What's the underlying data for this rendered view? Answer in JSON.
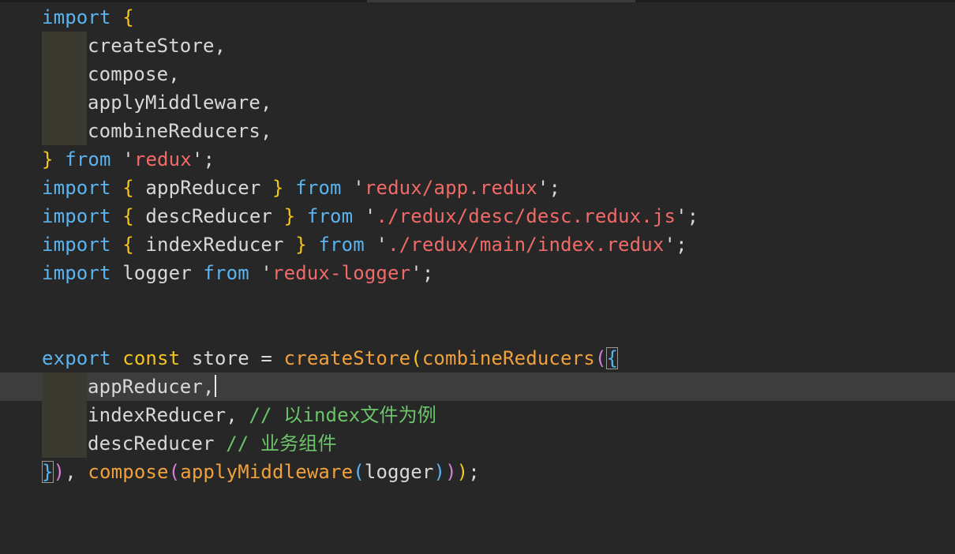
{
  "editor": {
    "lines": [
      {
        "id": "l1",
        "text": [
          "import",
          " ",
          "{"
        ]
      },
      {
        "id": "l2",
        "text": [
          "createStore",
          ","
        ]
      },
      {
        "id": "l3",
        "text": [
          "compose",
          ","
        ]
      },
      {
        "id": "l4",
        "text": [
          "applyMiddleware",
          ","
        ]
      },
      {
        "id": "l5",
        "text": [
          "combineReducers",
          ","
        ]
      },
      {
        "id": "l6",
        "text": [
          "}",
          " ",
          "from",
          " ",
          "'",
          "redux",
          "'",
          ";"
        ]
      },
      {
        "id": "l7",
        "text": [
          "import",
          " ",
          "{",
          " appReducer ",
          "}",
          " ",
          "from",
          " ",
          "'",
          "redux/app.redux",
          "'",
          ";"
        ]
      },
      {
        "id": "l8",
        "text": [
          "import",
          " ",
          "{",
          " descReducer ",
          "}",
          " ",
          "from",
          " ",
          "'",
          "./redux/desc/desc.redux.js",
          "'",
          ";"
        ]
      },
      {
        "id": "l9",
        "text": [
          "import",
          " ",
          "{",
          " indexReducer ",
          "}",
          " ",
          "from",
          " ",
          "'",
          "./redux/main/index.redux",
          "'",
          ";"
        ]
      },
      {
        "id": "l10",
        "text": [
          "import",
          " logger ",
          "from",
          " ",
          "'",
          "redux-logger",
          "'",
          ";"
        ]
      },
      {
        "id": "l13",
        "text": [
          "export",
          " ",
          "const",
          " store = ",
          "createStore",
          "(",
          "combineReducers",
          "(",
          "{"
        ]
      },
      {
        "id": "l14",
        "text": [
          "appReducer",
          ","
        ]
      },
      {
        "id": "l15",
        "text": [
          "indexReducer",
          ", ",
          "// 以index文件为例"
        ]
      },
      {
        "id": "l16",
        "text": [
          "descReducer",
          " ",
          "// 业务组件"
        ]
      },
      {
        "id": "l17",
        "text": [
          "}",
          ")",
          ", ",
          "compose",
          "(",
          "applyMiddleware",
          "(",
          "logger",
          ")",
          ")",
          ")",
          ";"
        ]
      }
    ]
  }
}
